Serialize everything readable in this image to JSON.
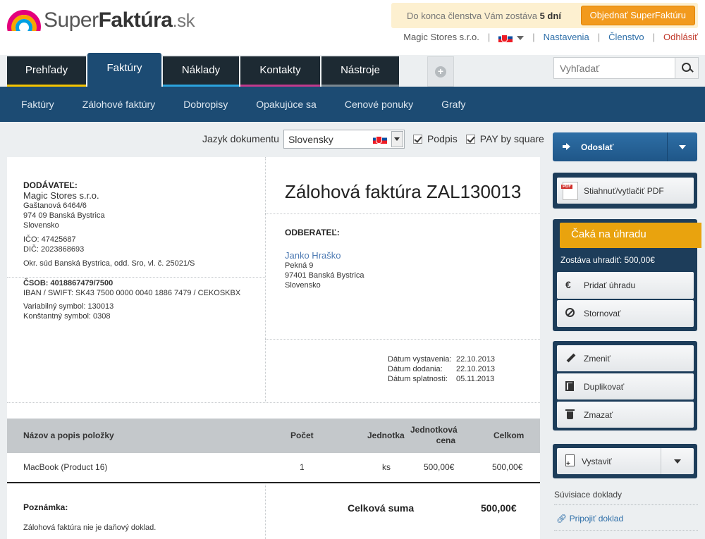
{
  "brand": {
    "name_part1": "Super",
    "name_part2": "Faktúra",
    "name_tld": ".sk"
  },
  "membership": {
    "text": "Do konca členstva Vám zostáva ",
    "days": "5 dní",
    "order_button": "Objednať SuperFaktúru"
  },
  "user_nav": {
    "company": "Magic Stores s.r.o.",
    "settings": "Nastavenia",
    "membership": "Členstvo",
    "logout": "Odhlásiť"
  },
  "tabs": [
    {
      "label": "Prehľady",
      "color": "#f5c400"
    },
    {
      "label": "Faktúry",
      "color": "#1c4b73"
    },
    {
      "label": "Náklady",
      "color": "#2ba3dd"
    },
    {
      "label": "Kontakty",
      "color": "#c03a8c"
    },
    {
      "label": "Nástroje",
      "color": "#7a8790"
    }
  ],
  "search": {
    "placeholder": "Vyhľadať"
  },
  "subnav": [
    "Faktúry",
    "Zálohové faktúry",
    "Dobropisy",
    "Opakujúce sa",
    "Cenové ponuky",
    "Grafy"
  ],
  "doc_options": {
    "language_label": "Jazyk dokumentu",
    "language_value": "Slovensky",
    "signature_label": "Podpis",
    "pay_by_square_label": "PAY by square"
  },
  "invoice": {
    "title": "Zálohová faktúra ZAL130013",
    "supplier": {
      "heading": "DODÁVATEĽ:",
      "name": "Magic Stores s.r.o.",
      "street": "Gaštanová 6464/6",
      "city": "974 09 Banská Bystrica",
      "country": "Slovensko",
      "ico": "IČO: 47425687",
      "dic": "DIČ: 2023868693",
      "court": "Okr. súd Banská Bystrica, odd. Sro, vl. č. 25021/S",
      "bank_label": "ČSOB: 4018867479/7500",
      "iban": "IBAN / SWIFT: SK43 7500 0000 0040 1886 7479 / CEKOSKBX",
      "variable_symbol": "Variabilný symbol: 130013",
      "constant_symbol": "Konštantný symbol: 0308"
    },
    "client": {
      "heading": "ODBERATEĽ:",
      "name": "Janko Hraško",
      "street": "Pekná 9",
      "city": "97401 Banská Bystrica",
      "country": "Slovensko"
    },
    "dates": [
      {
        "label": "Dátum vystavenia:",
        "value": "22.10.2013"
      },
      {
        "label": "Dátum dodania:",
        "value": "22.10.2013"
      },
      {
        "label": "Dátum splatnosti:",
        "value": "05.11.2013"
      }
    ],
    "columns": {
      "name": "Názov a popis položky",
      "qty": "Počet",
      "unit": "Jednotka",
      "unit_price_line1": "Jednotková",
      "unit_price_line2": "cena",
      "total": "Celkom"
    },
    "items": [
      {
        "name": "MacBook (Product 16)",
        "qty": "1",
        "unit": "ks",
        "unit_price": "500,00€",
        "total": "500,00€"
      }
    ],
    "note_heading": "Poznámka:",
    "note_text": "Zálohová faktúra nie je daňový doklad.",
    "total_label": "Celková suma",
    "total_value": "500,00€"
  },
  "sidebar": {
    "send": "Odoslať",
    "download_pdf": "Stiahnuť/vytlačiť PDF",
    "pdf_badge": "PDF",
    "status": "Čaká na úhradu",
    "remaining": "Zostáva uhradiť: 500,00€",
    "add_payment": "Pridať úhradu",
    "euro_symbol": "€",
    "cancel": "Stornovať",
    "edit": "Zmeniť",
    "duplicate": "Duplikovať",
    "delete": "Zmazať",
    "publish": "Vystaviť",
    "related_heading": "Súvisiace doklady",
    "attach": "Pripojiť doklad"
  }
}
